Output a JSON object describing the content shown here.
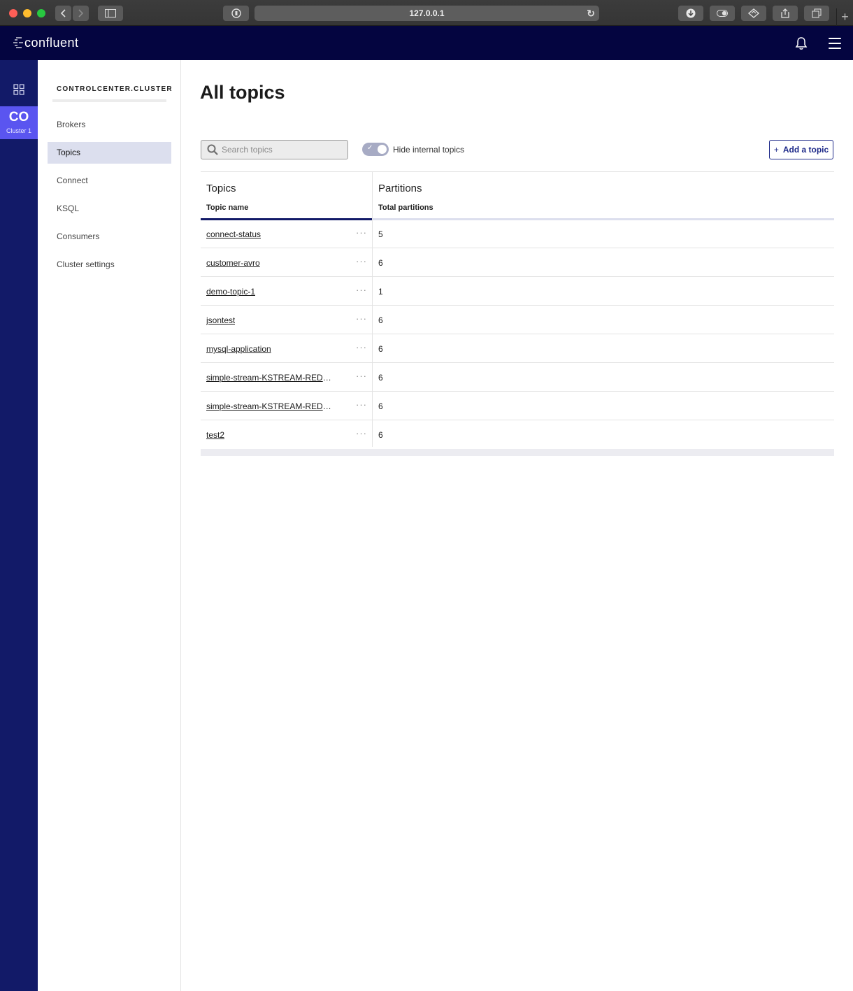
{
  "browser": {
    "url": "127.0.0.1"
  },
  "header": {
    "logo_text": "confluent"
  },
  "rail": {
    "cluster_abbr": "CO",
    "cluster_name": "Cluster 1",
    "tile_color": "#5a55f0"
  },
  "sidebar": {
    "cluster_title": "CONTROLCENTER.CLUSTER",
    "items": [
      {
        "label": "Brokers",
        "active": false
      },
      {
        "label": "Topics",
        "active": true
      },
      {
        "label": "Connect",
        "active": false
      },
      {
        "label": "KSQL",
        "active": false
      },
      {
        "label": "Consumers",
        "active": false
      },
      {
        "label": "Cluster settings",
        "active": false
      }
    ]
  },
  "main": {
    "title": "All topics",
    "search": {
      "placeholder": "Search topics",
      "value": ""
    },
    "toggle": {
      "label": "Hide internal topics",
      "checked": true
    },
    "add_button": {
      "icon": "+",
      "label": "Add a topic"
    }
  },
  "table": {
    "groups": [
      "Topics",
      "Partitions"
    ],
    "columns": [
      "Topic name",
      "Total partitions"
    ],
    "rows": [
      {
        "name": "connect-status",
        "partitions": "5"
      },
      {
        "name": "customer-avro",
        "partitions": "6"
      },
      {
        "name": "demo-topic-1",
        "partitions": "1"
      },
      {
        "name": "jsontest",
        "partitions": "6"
      },
      {
        "name": "mysql-application",
        "partitions": "6"
      },
      {
        "name": "simple-stream-KSTREAM-REDU…",
        "partitions": "6"
      },
      {
        "name": "simple-stream-KSTREAM-REDU…",
        "partitions": "6"
      },
      {
        "name": "test2",
        "partitions": "6"
      }
    ],
    "row_menu": "···"
  },
  "colors": {
    "appbar": "#040540",
    "rail": "#121a68",
    "accent": "#1f2b8a",
    "active_nav": "#dcdfee"
  }
}
